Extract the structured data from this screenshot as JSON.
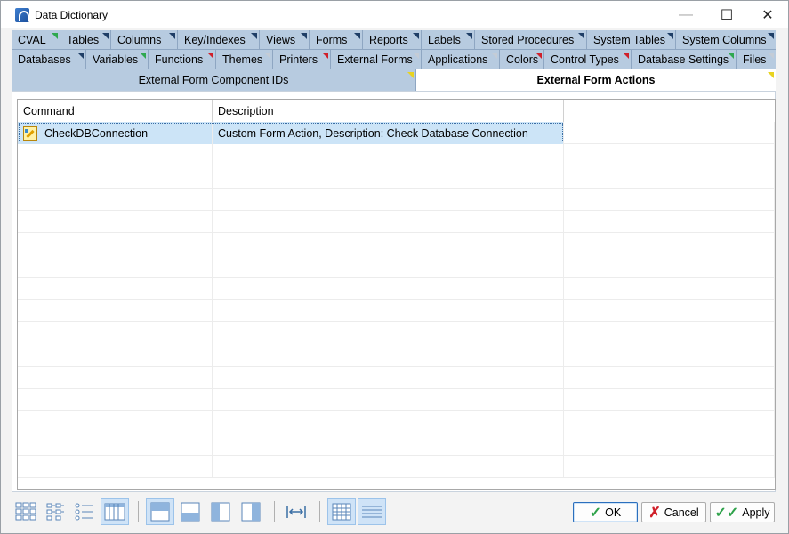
{
  "window": {
    "title": "Data Dictionary",
    "minimize_glyph": "—",
    "maximize_glyph": "☐",
    "close_glyph": "✕"
  },
  "tabs_row1": [
    {
      "label": "CVAL",
      "marker": "green"
    },
    {
      "label": "Tables",
      "marker": "navy"
    },
    {
      "label": "Columns",
      "marker": "navy"
    },
    {
      "label": "Key/Indexes",
      "marker": "navy"
    },
    {
      "label": "Views",
      "marker": "navy"
    },
    {
      "label": "Forms",
      "marker": "navy"
    },
    {
      "label": "Reports",
      "marker": "navy"
    },
    {
      "label": "Labels",
      "marker": "navy"
    },
    {
      "label": "Stored Procedures",
      "marker": "navy"
    },
    {
      "label": "System Tables",
      "marker": "navy"
    },
    {
      "label": "System Columns",
      "marker": "navy"
    }
  ],
  "tabs_row2": [
    {
      "label": "Databases",
      "marker": "navy"
    },
    {
      "label": "Variables",
      "marker": "green"
    },
    {
      "label": "Functions",
      "marker": "red"
    },
    {
      "label": "Themes",
      "marker": "grey"
    },
    {
      "label": "Printers",
      "marker": "red"
    },
    {
      "label": "External Forms",
      "marker": "grey"
    },
    {
      "label": "Applications",
      "marker": "grey"
    },
    {
      "label": "Colors",
      "marker": "red"
    },
    {
      "label": "Control Types",
      "marker": "red"
    },
    {
      "label": "Database Settings",
      "marker": "green"
    },
    {
      "label": "Files",
      "marker": "grey"
    }
  ],
  "subtabs": {
    "inactive": "External Form Component IDs",
    "active": "External Form Actions"
  },
  "grid": {
    "columns": [
      "Command",
      "Description",
      ""
    ],
    "rows": [
      {
        "command": "CheckDBConnection",
        "description": "Custom Form Action, Description: Check Database Connection",
        "icon": "action-icon"
      }
    ],
    "empty_rows": 15
  },
  "toolbar_icons": [
    "large-icons-view-icon",
    "small-icons-view-icon",
    "list-view-icon",
    "details-view-icon",
    "layout-top-icon",
    "layout-bottom-icon",
    "layout-left-icon",
    "layout-right-icon",
    "fit-columns-icon",
    "grid-lines-icon",
    "row-lines-icon"
  ],
  "buttons": {
    "ok": "OK",
    "cancel": "Cancel",
    "apply": "Apply"
  },
  "colors": {
    "tab_strip": "#5a7da3",
    "tab": "#b7cbe0",
    "selection": "#cce4f7",
    "marker_green": "#2fa84f",
    "marker_red": "#d0202a",
    "marker_navy": "#1f3e66",
    "marker_yellow": "#e8d320"
  }
}
